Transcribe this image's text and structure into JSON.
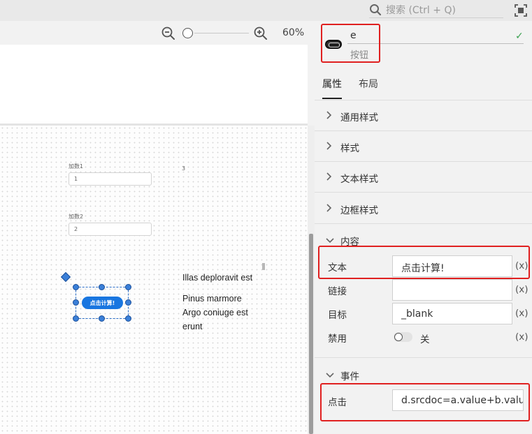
{
  "search": {
    "placeholder": "搜索 (Ctrl + Q)"
  },
  "zoom": {
    "level": "60%",
    "value_percent": 60
  },
  "canvas": {
    "field1_label": "加数1",
    "field1_value": "1",
    "field2_label": "加数2",
    "field2_value": "2",
    "result_value": "3",
    "button_label": "点击计算!",
    "text_block_1": "Illas deploravit est",
    "text_block_2_lines": [
      "Pinus marmore",
      "Argo coniuge est",
      "erunt"
    ]
  },
  "panel": {
    "element_name": "e",
    "element_type": "按钮",
    "tabs": [
      {
        "label": "属性",
        "active": true
      },
      {
        "label": "布局",
        "active": false
      }
    ],
    "collapsed_sections": [
      "通用样式",
      "样式",
      "文本样式",
      "边框样式"
    ],
    "content": {
      "title": "内容",
      "text_label": "文本",
      "text_value": "点击计算!",
      "link_label": "链接",
      "link_value": "",
      "target_label": "目标",
      "target_value": "_blank",
      "disabled_label": "禁用",
      "disabled_state": "关",
      "fx": "(x)"
    },
    "events": {
      "title": "事件",
      "click_label": "点击",
      "click_value": "d.srcdoc=a.value+b.value"
    }
  },
  "colors": {
    "accent_button": "#1976e0",
    "selection": "#3a7fd8",
    "highlight": "#e02020",
    "check": "#3aa050"
  },
  "icons": [
    "search-icon",
    "fit-screen-icon",
    "zoom-out-icon",
    "zoom-in-icon",
    "button-element-icon",
    "check-icon",
    "chevron-right-icon",
    "chevron-down-icon"
  ]
}
